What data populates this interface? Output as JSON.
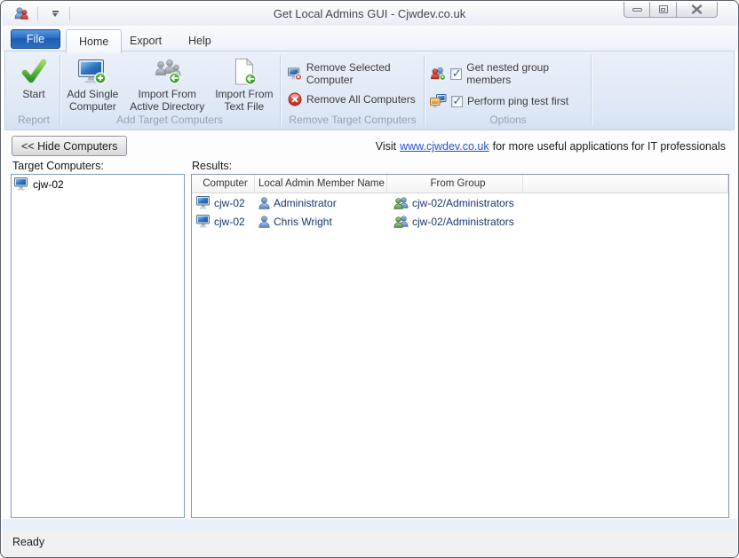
{
  "titlebar": {
    "title": "Get Local Admins GUI - Cjwdev.co.uk"
  },
  "tabs": {
    "file": "File",
    "home": "Home",
    "export": "Export",
    "help": "Help",
    "active": "Home"
  },
  "ribbon": {
    "report": {
      "label": "Report",
      "start": "Start"
    },
    "add": {
      "label": "Add Target Computers",
      "buttons": [
        "Add Single Computer",
        "Import From Active Directory",
        "Import From Text File"
      ]
    },
    "remove": {
      "label": "Remove Target Computers",
      "buttons": [
        "Remove Selected Computer",
        "Remove All Computers"
      ]
    },
    "options": {
      "label": "Options",
      "checkboxes": [
        {
          "label": "Get nested group members",
          "checked": true
        },
        {
          "label": "Perform ping test first",
          "checked": true
        }
      ]
    }
  },
  "toolbar": {
    "hide_computers": "<< Hide Computers",
    "visit_prefix": "Visit",
    "visit_link": "www.cjwdev.co.uk",
    "visit_suffix": "for more useful applications for IT professionals"
  },
  "panels": {
    "target_label": "Target Computers:",
    "results_label": "Results:",
    "computers": [
      {
        "name": "cjw-02"
      }
    ],
    "results": {
      "columns": [
        "Computer",
        "Local Admin Member Name",
        "From Group"
      ],
      "rows": [
        {
          "computer": "cjw-02",
          "member": "Administrator",
          "group": "cjw-02/Administrators"
        },
        {
          "computer": "cjw-02",
          "member": "Chris Wright",
          "group": "cjw-02/Administrators"
        }
      ]
    }
  },
  "statusbar": {
    "text": "Ready"
  },
  "colors": {
    "link": "#2a52cc",
    "result_text": "#17376e",
    "file_tab_blue": "#2a6cc4",
    "ribbon_bg": "#dde7f4",
    "badge_green": "#3faf30",
    "remove_red": "#d8352a"
  }
}
